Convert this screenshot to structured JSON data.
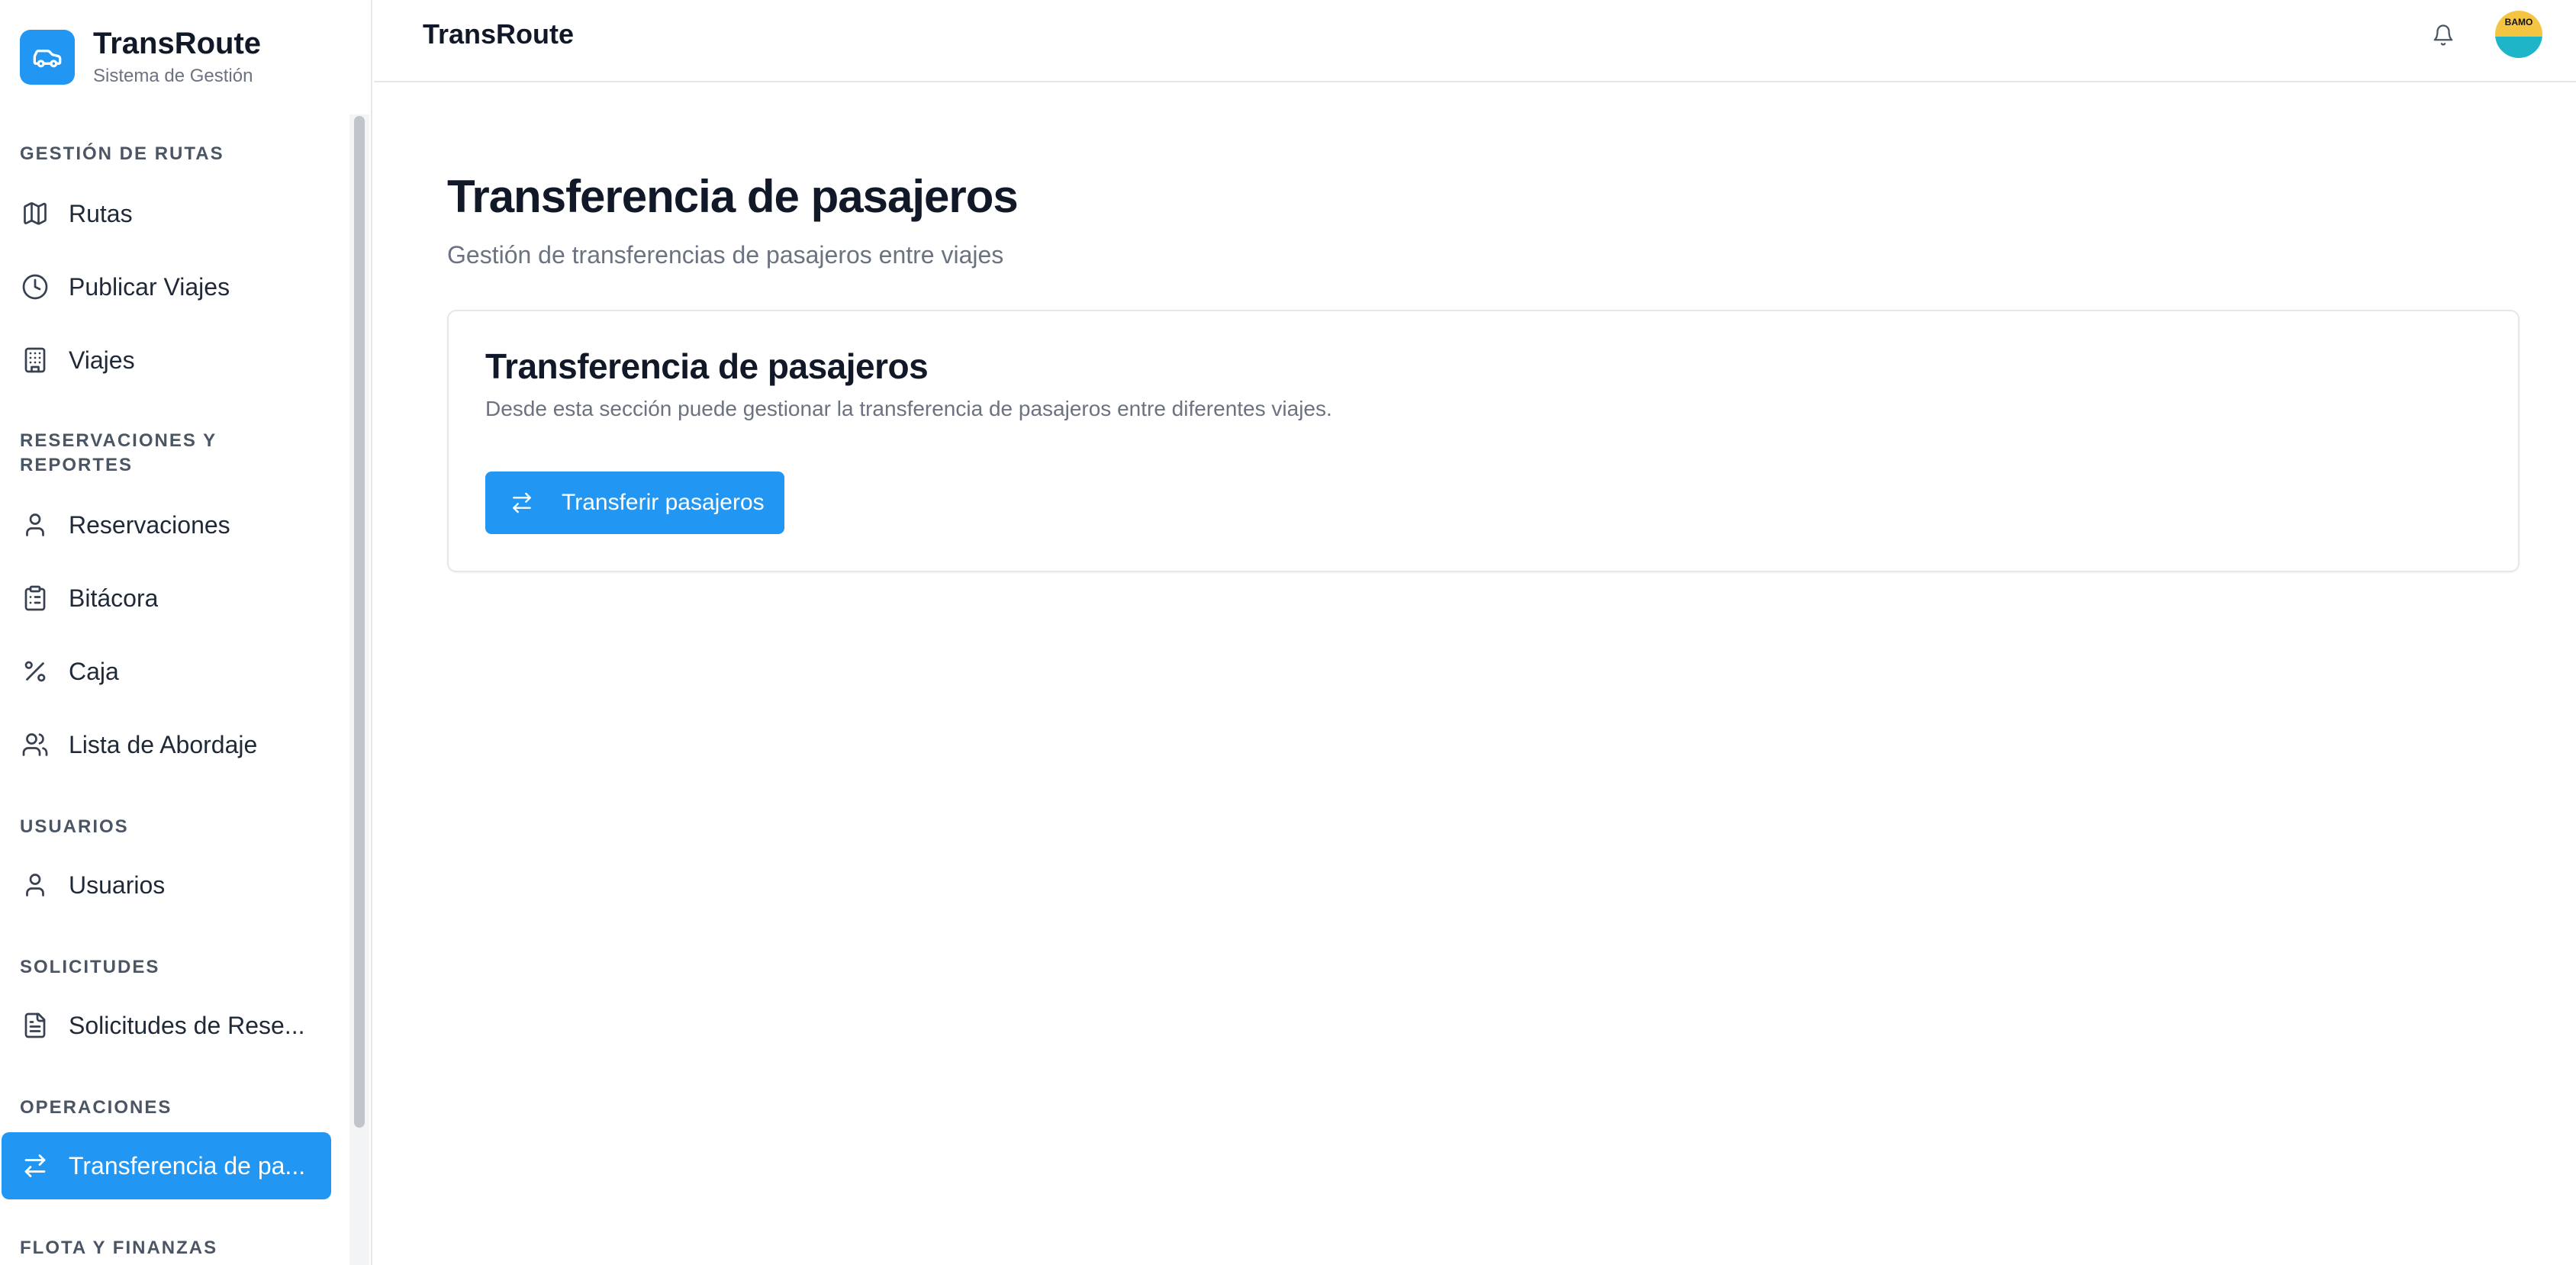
{
  "brand": {
    "title": "TransRoute",
    "subtitle": "Sistema de Gestión"
  },
  "sidebar": {
    "sections": [
      {
        "label": "GESTIÓN DE RUTAS"
      },
      {
        "label": "RESERVACIONES Y REPORTES"
      },
      {
        "label": "USUARIOS"
      },
      {
        "label": "SOLICITUDES"
      },
      {
        "label": "OPERACIONES"
      },
      {
        "label": "FLOTA Y FINANZAS"
      }
    ],
    "items": [
      {
        "label": "Rutas",
        "icon": "map-icon"
      },
      {
        "label": "Publicar Viajes",
        "icon": "clock-icon"
      },
      {
        "label": "Viajes",
        "icon": "building-icon"
      },
      {
        "label": "Reservaciones",
        "icon": "user-icon"
      },
      {
        "label": "Bitácora",
        "icon": "clipboard-icon"
      },
      {
        "label": "Caja",
        "icon": "percent-icon"
      },
      {
        "label": "Lista de Abordaje",
        "icon": "users-icon"
      },
      {
        "label": "Usuarios",
        "icon": "user-icon"
      },
      {
        "label": "Solicitudes de Rese...",
        "icon": "document-icon"
      },
      {
        "label": "Transferencia de pa...",
        "icon": "transfer-icon",
        "active": true
      }
    ]
  },
  "header": {
    "title": "TransRoute",
    "avatar_text": "BAMO"
  },
  "main": {
    "title": "Transferencia de pasajeros",
    "subtitle": "Gestión de transferencias de pasajeros entre viajes",
    "card": {
      "title": "Transferencia de pasajeros",
      "description": "Desde esta sección puede gestionar la transferencia de pasajeros entre diferentes viajes.",
      "button_label": "Transferir pasajeros"
    }
  },
  "colors": {
    "accent": "#2196f3",
    "text_primary": "#111827",
    "text_muted": "#6b7280",
    "border": "#e5e7eb"
  }
}
